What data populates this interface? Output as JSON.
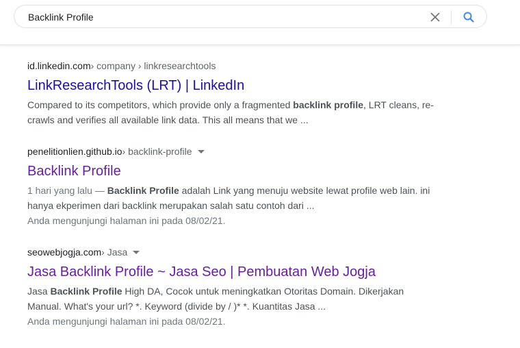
{
  "search": {
    "query": "Backlink Profile"
  },
  "colors": {
    "link": "#1a0dab",
    "visited_link": "#681da8",
    "search_icon": "#4285f4"
  },
  "icons": {
    "clear": "close-icon",
    "search": "search-icon",
    "menu": "caret-down-icon"
  },
  "results": [
    {
      "domain": "id.linkedin.com",
      "path": " › company › linkresearchtools",
      "title": "LinkResearchTools (LRT) | LinkedIn",
      "date": "",
      "snippet": {
        "pre": "Compared to its competitors, which provide only a fragmented ",
        "bold": "backlink profile",
        "post": ", LRT cleans, re-crawls and verifies all available link data. This all means that we ..."
      },
      "visited_note": ""
    },
    {
      "domain": "penelitionlien.github.io",
      "path": " › backlink-profile",
      "title": "Backlink Profile",
      "date": "1 hari yang lalu — ",
      "snippet": {
        "pre": "",
        "bold": "Backlink Profile",
        "post": " adalah Link yang menuju website lewat profile web lain. ini hanya ekperimen dari backlink merupakan salah satu contoh dari ..."
      },
      "visited_note": "Anda mengunjungi halaman ini pada 08/02/21."
    },
    {
      "domain": "seowebjogja.com",
      "path": " › Jasa",
      "title": "Jasa Backlink Profile ~ Jasa Seo | Pembuatan Web Jogja",
      "date": "",
      "snippet": {
        "pre": "Jasa ",
        "bold": "Backlink Profile",
        "post": " High DA, Cocok untuk meningkatkan Otoritas Domain. Dikerjakan Manual. What's your url? *. Keyword (divide by / )* *. Kuantitas Jasa ..."
      },
      "visited_note": "Anda mengunjungi halaman ini pada 08/02/21."
    }
  ]
}
